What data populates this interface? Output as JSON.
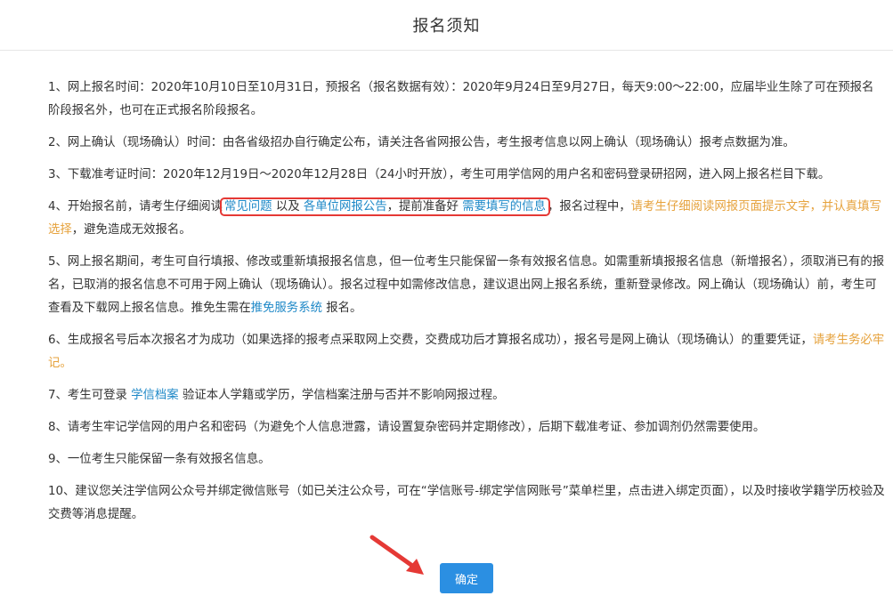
{
  "header": {
    "title": "报名须知"
  },
  "paragraphs": {
    "p1": "1、网上报名时间：2020年10月10日至10月31日，预报名（报名数据有效）：2020年9月24日至9月27日，每天9:00～22:00，应届毕业生除了可在预报名阶段报名外，也可在正式报名阶段报名。",
    "p2": "2、网上确认（现场确认）时间：由各省级招办自行确定公布，请关注各省网报公告，考生报考信息以网上确认（现场确认）报考点数据为准。",
    "p3": "3、下载准考证时间：2020年12月19日～2020年12月28日（24小时开放），考生可用学信网的用户名和密码登录研招网，进入网上报名栏目下载。",
    "p4": {
      "prefix": "4、开始报名前，请考生仔细阅读",
      "link_faq": "常见问题",
      "yiji": " 以及 ",
      "link_notice": "各单位网报公告",
      "mid": "，提前准备好 ",
      "link_info": "需要填写的信息",
      "after": "，报名过程中，",
      "orange": "请考生仔细阅读网报页面提示文字，并认真填写选择",
      "suffix": "，避免造成无效报名。"
    },
    "p5": {
      "text": "5、网上报名期间，考生可自行填报、修改或重新填报报名信息，但一位考生只能保留一条有效报名信息。如需重新填报报名信息（新增报名），须取消已有的报名，已取消的报名信息不可用于网上确认（现场确认）。报名过程中如需修改信息，建议退出网上报名系统，重新登录修改。网上确认（现场确认）前，考生可查看及下载网上报名信息。推免生需在",
      "link": "推免服务系统",
      "suffix": " 报名。"
    },
    "p6": {
      "text": "6、生成报名号后本次报名才为成功（如果选择的报考点采取网上交费，交费成功后才算报名成功），报名号是网上确认（现场确认）的重要凭证，",
      "orange": "请考生务必牢记。"
    },
    "p7": {
      "prefix": "7、考生可登录 ",
      "link": "学信档案",
      "suffix": " 验证本人学籍或学历，学信档案注册与否并不影响网报过程。"
    },
    "p8": "8、请考生牢记学信网的用户名和密码（为避免个人信息泄露，请设置复杂密码并定期修改），后期下载准考证、参加调剂仍然需要使用。",
    "p9": "9、一位考生只能保留一条有效报名信息。",
    "p10": "10、建议您关注学信网公众号并绑定微信账号（如已关注公众号，可在“学信账号-绑定学信网账号”菜单栏里，点击进入绑定页面），以及时接收学籍学历校验及交费等消息提醒。"
  },
  "confirm_button": {
    "label": "确定"
  },
  "colors": {
    "link": "#1e88c7",
    "highlight": "#e6a23c",
    "button": "#2b8fe2",
    "annotation": "#e53935"
  }
}
